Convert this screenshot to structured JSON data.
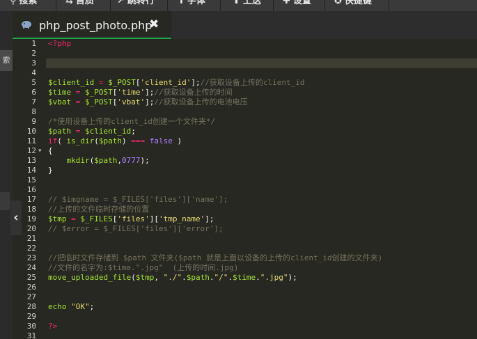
{
  "toolbar": {
    "items": [
      {
        "icon": "search-icon",
        "label": "搜索"
      },
      {
        "icon": "indent-icon",
        "label": "首质"
      },
      {
        "icon": "goto-line-icon",
        "label": "跳转行"
      },
      {
        "icon": "font-icon",
        "label": "字体"
      },
      {
        "icon": "upload-icon",
        "label": "上送"
      },
      {
        "icon": "settings-icon",
        "label": "设置"
      },
      {
        "icon": "shortcut-icon",
        "label": "快捷键"
      }
    ]
  },
  "sidebar": {
    "tab_label": "索"
  },
  "editor": {
    "tab_title": "php_post_photo.php",
    "tab_close": "✖",
    "active_line": 4,
    "folded_line": 12
  },
  "line_numbers": [
    "1",
    "2",
    "3",
    "4",
    "5",
    "6",
    "7",
    "8",
    "9",
    "10",
    "11",
    "12",
    "13",
    "14",
    "15",
    "16",
    "17",
    "18",
    "19",
    "20",
    "21",
    "22",
    "23",
    "24",
    "25",
    "26",
    "27",
    "28",
    "29",
    "30",
    "31"
  ]
}
